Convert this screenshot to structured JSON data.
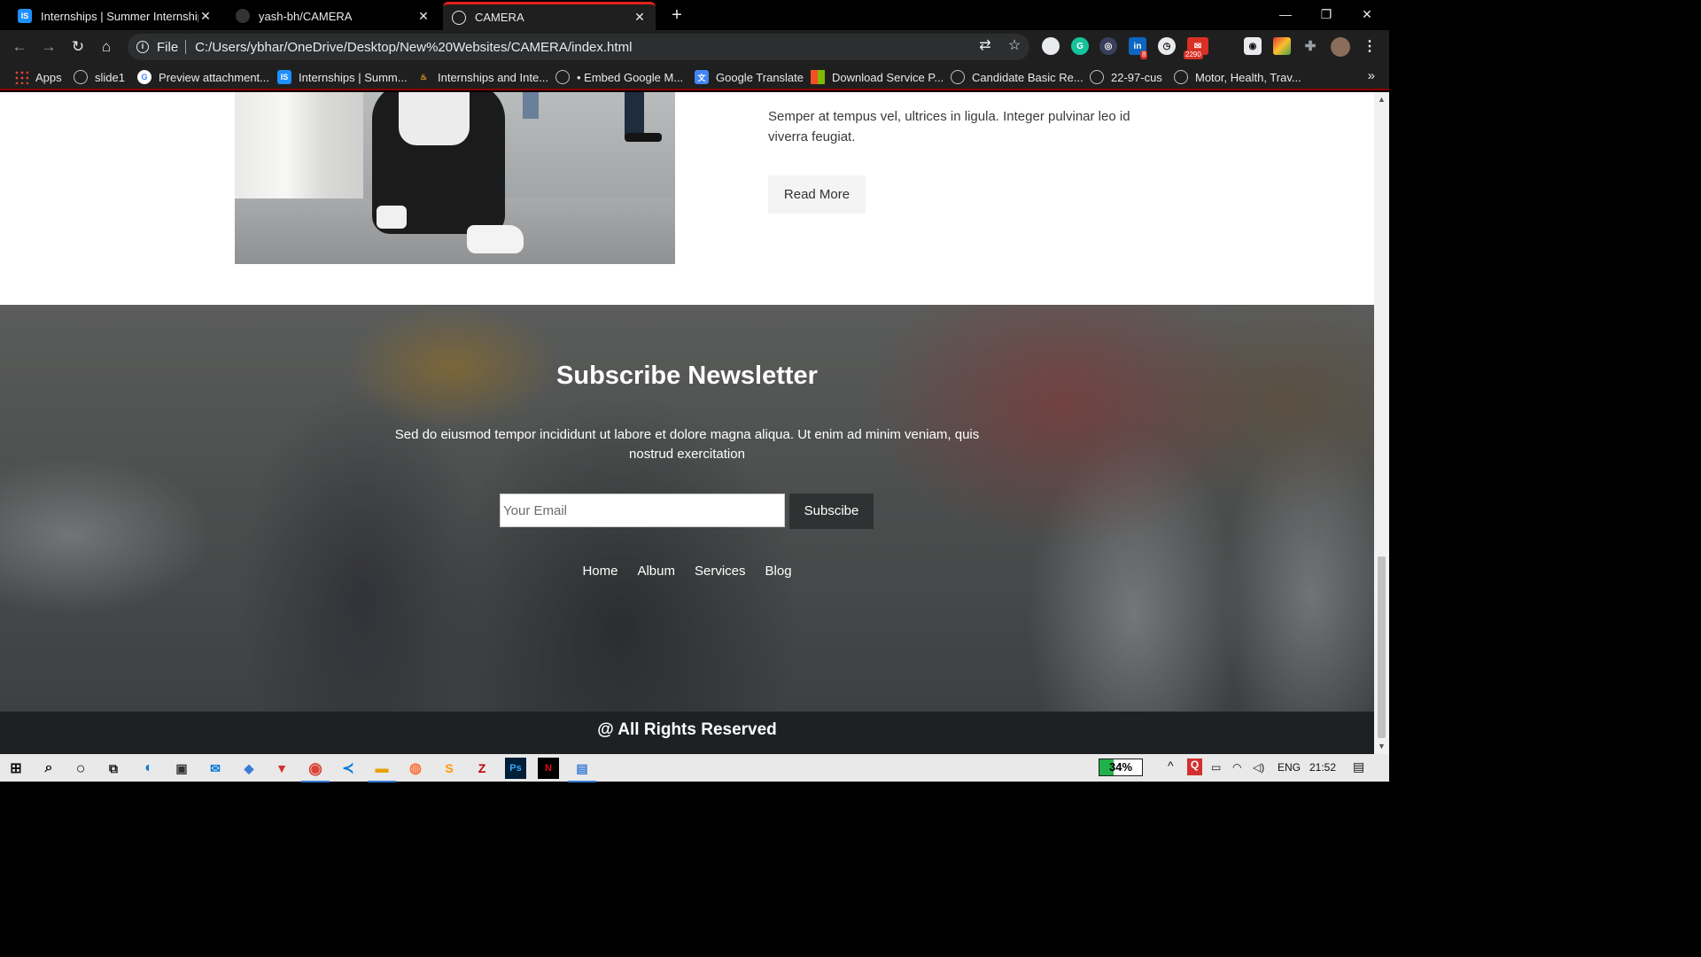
{
  "browser": {
    "tabs": [
      {
        "title": "Internships | Summer Internship",
        "favicon": "internshala-icon",
        "active": false
      },
      {
        "title": "yash-bh/CAMERA",
        "favicon": "github-icon",
        "active": false
      },
      {
        "title": "CAMERA",
        "favicon": "globe-icon",
        "active": true
      }
    ],
    "address": {
      "scheme": "File",
      "url": "C:/Users/ybhar/OneDrive/Desktop/New%20Websites/CAMERA/index.html"
    },
    "extension_badges": {
      "linkedin": "8",
      "mail": "2290"
    },
    "bookmarks": [
      {
        "label": "Apps",
        "icon": "apps-grid-icon"
      },
      {
        "label": "slide1",
        "icon": "globe-icon"
      },
      {
        "label": "Preview attachment...",
        "icon": "google-icon"
      },
      {
        "label": "Internships | Summ...",
        "icon": "internshala-icon"
      },
      {
        "label": "Internships and Inte...",
        "icon": "fire-icon"
      },
      {
        "label": "• Embed Google M...",
        "icon": "globe-icon"
      },
      {
        "label": "Google Translate",
        "icon": "translate-icon"
      },
      {
        "label": "Download Service P...",
        "icon": "microsoft-icon"
      },
      {
        "label": "Candidate Basic Re...",
        "icon": "globe-icon"
      },
      {
        "label": "22-97-cus",
        "icon": "globe-icon"
      },
      {
        "label": "Motor, Health, Trav...",
        "icon": "globe-icon"
      }
    ],
    "bookmarks_more": "»"
  },
  "page": {
    "article_text": "Semper at tempus vel, ultrices in ligula. Integer pulvinar leo id viverra feugiat.",
    "read_more": "Read More",
    "newsletter": {
      "title": "Subscribe Newsletter",
      "text": "Sed do eiusmod tempor incididunt ut labore et dolore magna aliqua. Ut enim ad minim veniam, quis nostrud exercitation",
      "email_placeholder": "Your Email",
      "subscribe_label": "Subscibe",
      "nav": [
        "Home",
        "Album",
        "Services",
        "Blog"
      ]
    },
    "footer": "@ All Rights Reserved"
  },
  "taskbar": {
    "battery": "34%",
    "battery_level": 0.34,
    "language": "ENG",
    "time": "21:52"
  },
  "colors": {
    "active_tab_accent": "#e0231c",
    "footer_bg": "#1e2124",
    "subscribe_bg": "#2f3132",
    "battery_fill": "#21b14b"
  }
}
